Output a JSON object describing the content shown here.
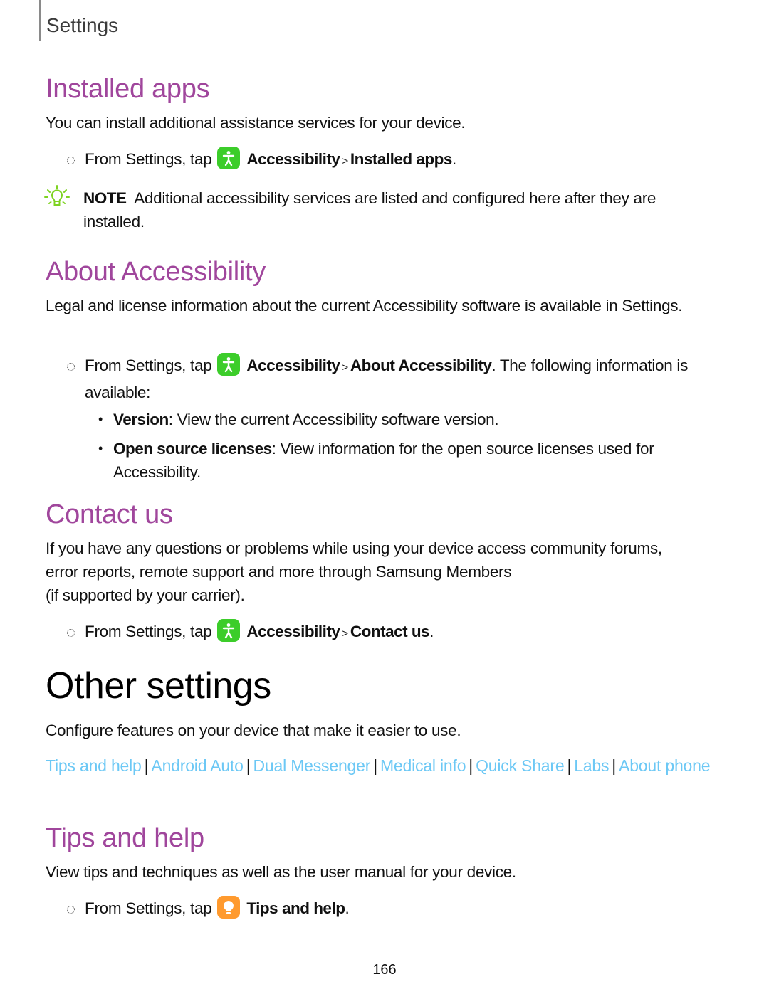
{
  "running_head": "Settings",
  "sections": {
    "installed_apps": {
      "title": "Installed apps",
      "body": "You can install additional assistance services for your device.",
      "step": {
        "prefix": "From Settings, tap",
        "icon": "accessibility-icon",
        "path1": "Accessibility",
        "separator": ">",
        "path2": "Installed apps",
        "suffix": "."
      },
      "note": {
        "label": "NOTE",
        "text": "Additional accessibility services are listed and configured here after they are installed."
      }
    },
    "about_accessibility": {
      "title": "About Accessibility",
      "body": "Legal and license information about the current Accessibility software is available in Settings.",
      "step": {
        "prefix": "From Settings, tap",
        "icon": "accessibility-icon",
        "path1": "Accessibility",
        "separator": ">",
        "path2": "About Accessibility",
        "suffix": ". The following information is available:"
      },
      "items": [
        {
          "term": "Version",
          "text": ": View the current Accessibility software version."
        },
        {
          "term": "Open source licenses",
          "text": ": View information for the open source licenses used for Accessibility."
        }
      ]
    },
    "contact_us": {
      "title": "Contact us",
      "body_line1": "If you have any questions or problems while using your device access community forums, error reports, remote support and more through Samsung Members",
      "body_line2": "(if supported by your carrier).",
      "step": {
        "prefix": "From Settings, tap",
        "icon": "accessibility-icon",
        "path1": "Accessibility",
        "separator": ">",
        "path2": "Contact us",
        "suffix": "."
      }
    }
  },
  "chapter": {
    "title": "Other settings",
    "intro": "Configure features on your device that make it easier to use.",
    "links": [
      "Tips and help",
      "Android Auto",
      "Dual Messenger",
      "Medical info",
      "Quick Share",
      "Labs",
      "About phone"
    ],
    "link_separator": "|"
  },
  "tips_and_help": {
    "title": "Tips and help",
    "body": "View tips and techniques as well as the user manual for your device.",
    "step": {
      "prefix": "From Settings, tap",
      "icon": "tips-icon",
      "path1": "Tips and help",
      "suffix": "."
    }
  },
  "colors": {
    "section_heading": "#a0469c",
    "link": "#6cc8f5",
    "accessibility_icon": "#3ccd2a",
    "tips_icon": "#ff9a2e",
    "note_icon": "#7ed321"
  },
  "page_number": "166"
}
